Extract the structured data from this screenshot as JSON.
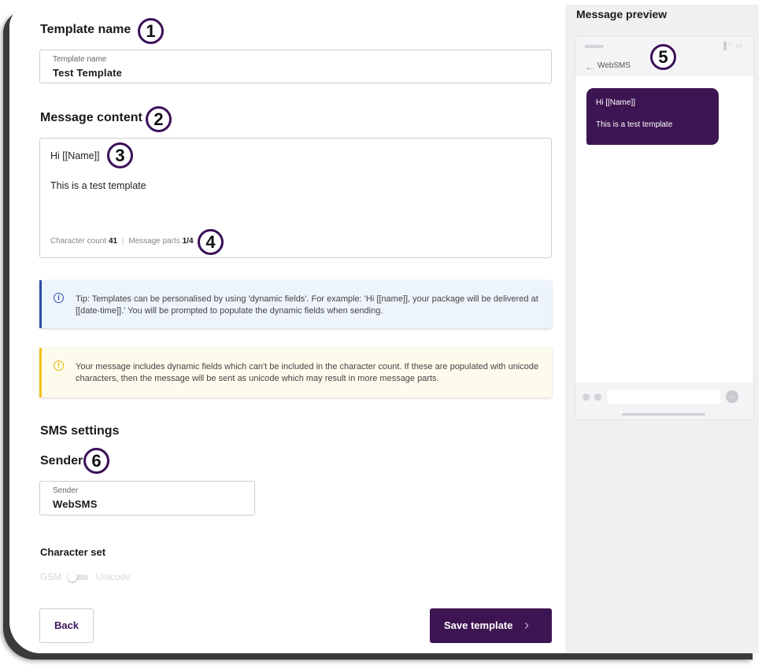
{
  "template": {
    "heading": "Template name",
    "field_label": "Template name",
    "field_value": "Test Template"
  },
  "content": {
    "heading": "Message content",
    "line1": "Hi [[Name]]",
    "line2": "This is a test template",
    "char_count_label": "Character count",
    "char_count": "41",
    "separator": "|",
    "parts_label": "Message parts",
    "parts_value": "1/4"
  },
  "tip": {
    "icon": "info-icon",
    "text": "Tip: Templates can be personalised by using 'dynamic fields'. For example: 'Hi [[name]], your package will be delivered at [[date-time]].' You will be prompted to populate the dynamic fields when sending.",
    "accent": "#2a4fa8"
  },
  "warning": {
    "icon": "warning-icon",
    "text": "Your message includes dynamic fields which can't be included in the character count. If these are populated with unicode characters, then the message will be sent as unicode which may result in more message parts.",
    "accent": "#f0c419"
  },
  "sms_settings": {
    "heading": "SMS settings",
    "sender_heading": "Sender",
    "sender_label": "Sender",
    "sender_value": "WebSMS",
    "charset_heading": "Character set",
    "charset_left": "GSM",
    "charset_right": "Unicode",
    "charset_selected": "GSM"
  },
  "buttons": {
    "back": "Back",
    "save": "Save template"
  },
  "preview": {
    "title": "Message preview",
    "sender": "WebSMS",
    "bubble_line1": "Hi [[Name]]",
    "bubble_line2": "This is a test template"
  },
  "markers": [
    "1",
    "2",
    "3",
    "4",
    "5",
    "6"
  ],
  "colors": {
    "brand": "#3d1552",
    "marker_ring": "#3a1057"
  }
}
